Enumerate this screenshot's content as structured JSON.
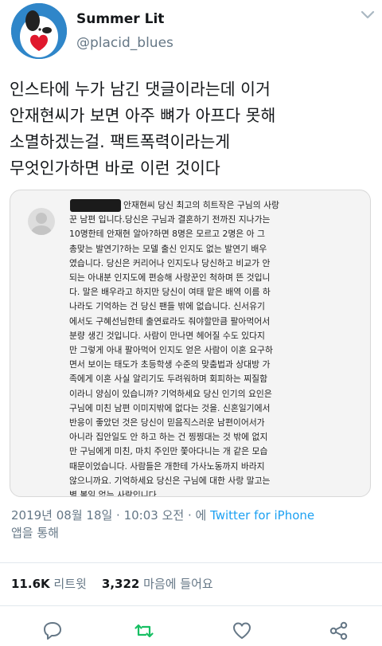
{
  "tweet": {
    "display_name": "Summer Lit",
    "handle": "@placid_blues",
    "text_lines": [
      "인스타에 누가 남긴 댓글이라는데 이거",
      "안재현씨가 보면 아주 뼈가 아프다 못해",
      "소멸하겠는걸. 팩트폭력이라는게",
      "무엇인가하면 바로 이런 것이다"
    ],
    "timestamp": "2019년 08월 18일 · 10:03 오전 · 에 ",
    "source_link": "Twitter for iPhone",
    "source_suffix": "앱을 통해"
  },
  "attached_comment": {
    "lines": [
      "안재현씨 당신 최고의 히트작은 구님의 사랑",
      "꾼 남편 입니다.당신은 구님과 결혼하기 전까진 지나가는",
      "10명한테 안재현 알아?하면 8명은 모르고 2명은 아 그",
      "총맞는 발연기?하는 모델 출신 인지도 없는 발연기 배우",
      "였습니다. 당신은 커리어나 인지도나 당신하고 비교가 안",
      "되는 아내분 인지도에 편승해 사랑꾼인 척하며 뜬 것입니",
      "다. 말은 배우라고 하지만 당신이 여태 맡은 배역 이름 하",
      "나라도 기억하는 건 당신 팬들 밖에 없습니다. 신서유기",
      "에서도 구혜선님한테 출연료라도 줘야할만큼 팔아먹어서",
      "분량 생긴 것입니다. 사람이 만나면 헤어질 수도 있다지",
      "만 그렇게 아내 팔아먹어 인지도 얻은 사람이 이혼 요구하",
      "면서 보이는 태도가 초등학생 수준의 맞춤법과 상대방 가",
      "족에게 이혼 사실 알리기도 두려워하며 회피하는 찌질함",
      "이라니 양심이 있습니까? 기억하세요 당신 인기의 요인은",
      "구님에 미친 남편 이미지밖에 없다는 것을. 신혼일기에서",
      "반응이 좋았던 것은 당신이 믿음직스러운 남편이어서가",
      "아니라 집안일도 안 하고 하는 건 찡찡대는 것 밖에 없지",
      "만 구님에게 미친, 마치 주인만 쫓아다니는 개 같은 모습",
      "때문이었습니다. 사람들은 개한테 가사노동까지 바라지",
      "않으니까요. 기억하세요 당신은 구님에 대한 사랑 말고는",
      "별 볼일 없는 사람입니다."
    ]
  },
  "stats": {
    "retweets_count": "11.6K",
    "retweets_label": "리트윗",
    "likes_count": "3,322",
    "likes_label": "마음에 들어요"
  },
  "icons": [
    "chevron-down-icon",
    "reply-icon",
    "retweet-icon",
    "like-icon",
    "share-icon"
  ],
  "colors": {
    "link": "#1da1f2",
    "retweet_active": "#17bf63",
    "secondary_text": "#657786"
  }
}
